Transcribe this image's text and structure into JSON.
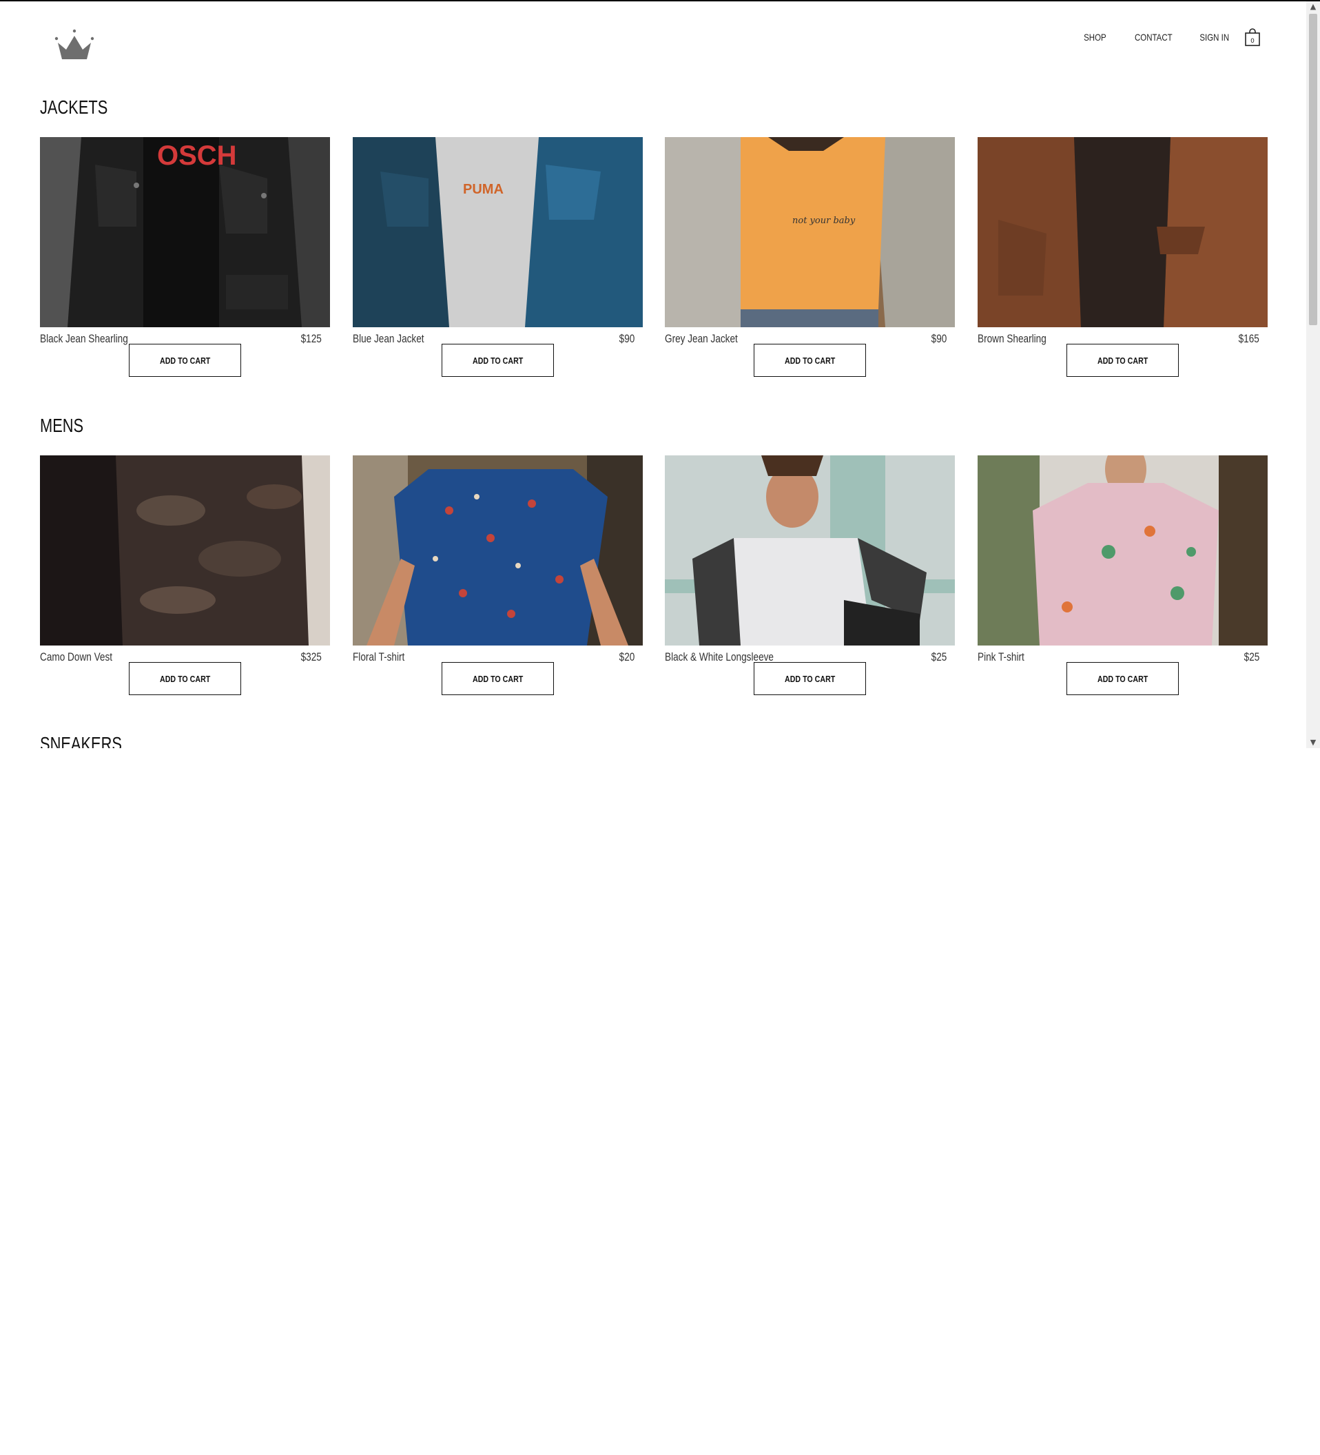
{
  "header": {
    "nav": [
      {
        "label": "SHOP"
      },
      {
        "label": "CONTACT"
      },
      {
        "label": "SIGN IN"
      }
    ],
    "logo_icon": "crown-icon",
    "cart_icon": "shopping-bag-icon"
  },
  "sections": [
    {
      "title": "JACKETS",
      "items": [
        {
          "name": "Black Jean Shearling",
          "price": "$125",
          "button": "ADD TO CART"
        },
        {
          "name": "Blue Jean Jacket",
          "price": "$90",
          "button": "ADD TO CART"
        },
        {
          "name": "Grey Jean Jacket",
          "price": "$90",
          "button": "ADD TO CART"
        },
        {
          "name": "Brown Shearling",
          "price": "$165",
          "button": "ADD TO CART"
        }
      ]
    },
    {
      "title": "MENS",
      "items": [
        {
          "name": "Camo Down Vest",
          "price": "$325",
          "button": "ADD TO CART"
        },
        {
          "name": "Floral T-shirt",
          "price": "$20",
          "button": "ADD TO CART"
        },
        {
          "name": "Black & White Longsleeve",
          "price": "$25",
          "button": "ADD TO CART"
        },
        {
          "name": "Pink T-shirt",
          "price": "$25",
          "button": "ADD TO CART"
        }
      ]
    },
    {
      "title": "SNEAKERS"
    }
  ],
  "colors": {
    "text": "#111111",
    "secondary_text": "#333333",
    "background": "#ffffff",
    "logo": "#6e6e6e"
  }
}
